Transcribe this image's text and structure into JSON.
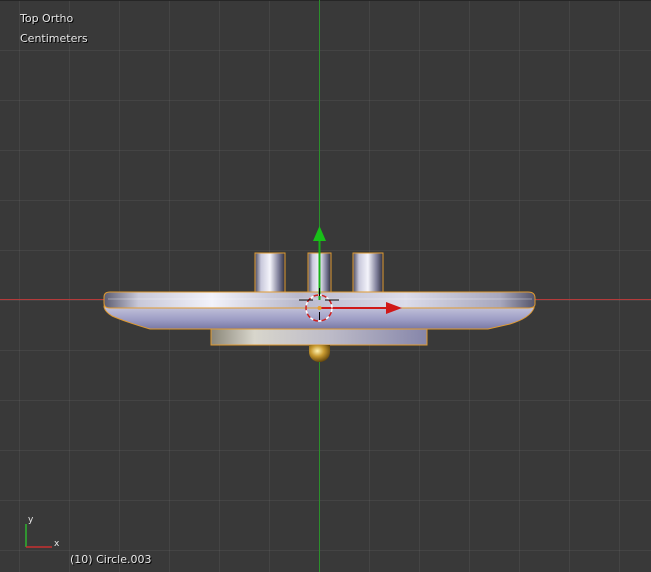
{
  "viewport": {
    "view_name": "Top Ortho",
    "unit_system": "Centimeters",
    "active_object": "(10) Circle.003",
    "axis_icon": {
      "y_label": "y",
      "x_label": "x"
    },
    "colors": {
      "background": "#393939",
      "x_axis": "#c43a3a",
      "y_axis": "#2e9a2e",
      "selection_outline": "#f0a030",
      "manipulator_x": "#d02020",
      "manipulator_y": "#20b020"
    }
  }
}
